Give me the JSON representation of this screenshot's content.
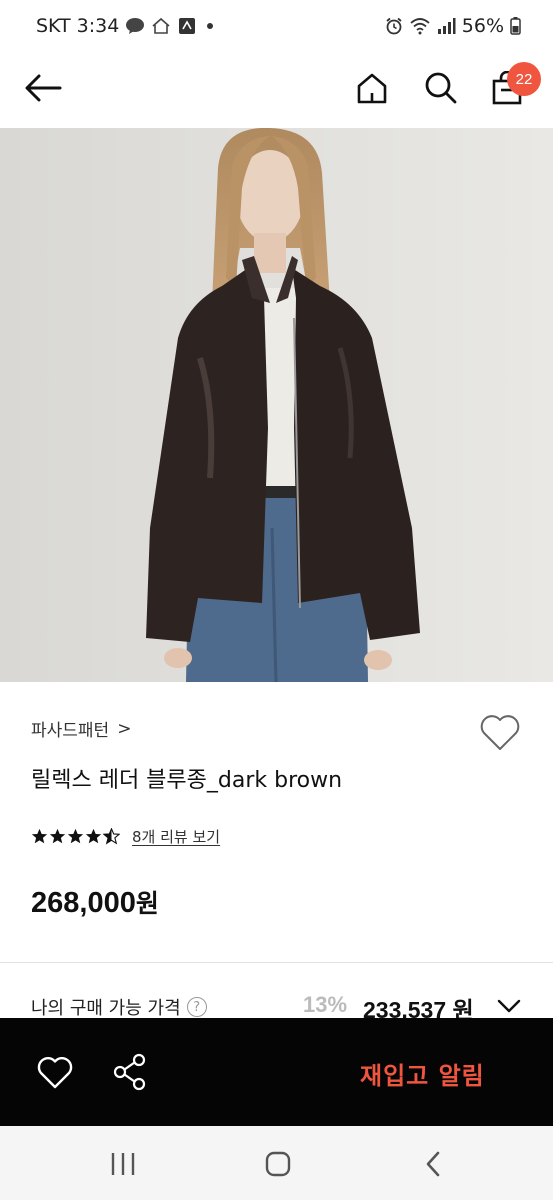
{
  "status_bar": {
    "carrier": "SKT",
    "time": "3:34",
    "battery": "56%"
  },
  "header": {
    "cart_count": "22"
  },
  "product": {
    "brand": "파사드패턴",
    "brand_chevron": ">",
    "title": "릴렉스 레더 블루종_dark brown",
    "rating": 4.5,
    "review_link": "8개 리뷰 보기",
    "price": "268,000",
    "price_unit": "원"
  },
  "purchase": {
    "label": "나의 구매 가능 가격",
    "help": "?",
    "discount": "13%",
    "final_price": "233,537",
    "final_unit": "원"
  },
  "action_bar": {
    "restock_label": "재입고 알림"
  },
  "colors": {
    "accent": "#f0563f",
    "action_bar_bg": "#050505"
  },
  "icons": {
    "back": "arrow-left-icon",
    "home": "home-icon",
    "search": "search-icon",
    "cart": "shopping-bag-icon",
    "like": "heart-icon",
    "share": "share-icon"
  }
}
